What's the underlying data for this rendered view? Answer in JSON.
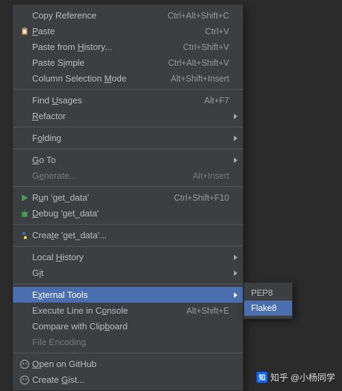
{
  "menu": {
    "copyReference": {
      "label": "Copy Reference",
      "shortcut": "Ctrl+Alt+Shift+C"
    },
    "paste": {
      "labelPre": "",
      "u": "P",
      "labelPost": "aste",
      "shortcut": "Ctrl+V"
    },
    "pasteHistory": {
      "labelPre": "Paste from ",
      "u": "H",
      "labelPost": "istory...",
      "shortcut": "Ctrl+Shift+V"
    },
    "pasteSimple": {
      "labelPre": "Paste S",
      "u": "i",
      "labelPost": "mple",
      "shortcut": "Ctrl+Alt+Shift+V"
    },
    "columnMode": {
      "labelPre": "Column Selection ",
      "u": "M",
      "labelPost": "ode",
      "shortcut": "Alt+Shift+Insert"
    },
    "findUsages": {
      "labelPre": "Find ",
      "u": "U",
      "labelPost": "sages",
      "shortcut": "Alt+F7"
    },
    "refactor": {
      "labelPre": "",
      "u": "R",
      "labelPost": "efactor"
    },
    "folding": {
      "labelPre": "F",
      "u": "o",
      "labelPost": "lding"
    },
    "goto": {
      "labelPre": "",
      "u": "G",
      "labelPost": "o To"
    },
    "generate": {
      "labelPre": "G",
      "u": "e",
      "labelPost": "nerate...",
      "shortcut": "Alt+Insert"
    },
    "run": {
      "labelPre": "R",
      "u": "u",
      "labelPost": "n 'get_data'",
      "shortcut": "Ctrl+Shift+F10"
    },
    "debug": {
      "labelPre": "",
      "u": "D",
      "labelPost": "ebug 'get_data'"
    },
    "create": {
      "labelPre": "Crea",
      "u": "t",
      "labelPost": "e 'get_data'..."
    },
    "localHistory": {
      "labelPre": "Local ",
      "u": "H",
      "labelPost": "istory"
    },
    "git": {
      "labelPre": "G",
      "u": "i",
      "labelPost": "t"
    },
    "externalTools": {
      "labelPre": "E",
      "u": "x",
      "labelPost": "ternal Tools"
    },
    "execConsole": {
      "labelPre": "Execute Line in C",
      "u": "o",
      "labelPost": "nsole",
      "shortcut": "Alt+Shift+E"
    },
    "compareClipboard": {
      "labelPre": "Compare with Clip",
      "u": "b",
      "labelPost": "oard"
    },
    "fileEncoding": {
      "label": "File Encoding"
    },
    "openGithub": {
      "labelPre": "",
      "u": "O",
      "labelPost": "pen on GitHub"
    },
    "createGist": {
      "labelPre": "Create ",
      "u": "G",
      "labelPost": "ist..."
    }
  },
  "submenu": {
    "pep8": "PEP8",
    "flake8": "Flake8"
  },
  "watermark": {
    "logo": "知",
    "text": "知乎 @小杨同学"
  }
}
